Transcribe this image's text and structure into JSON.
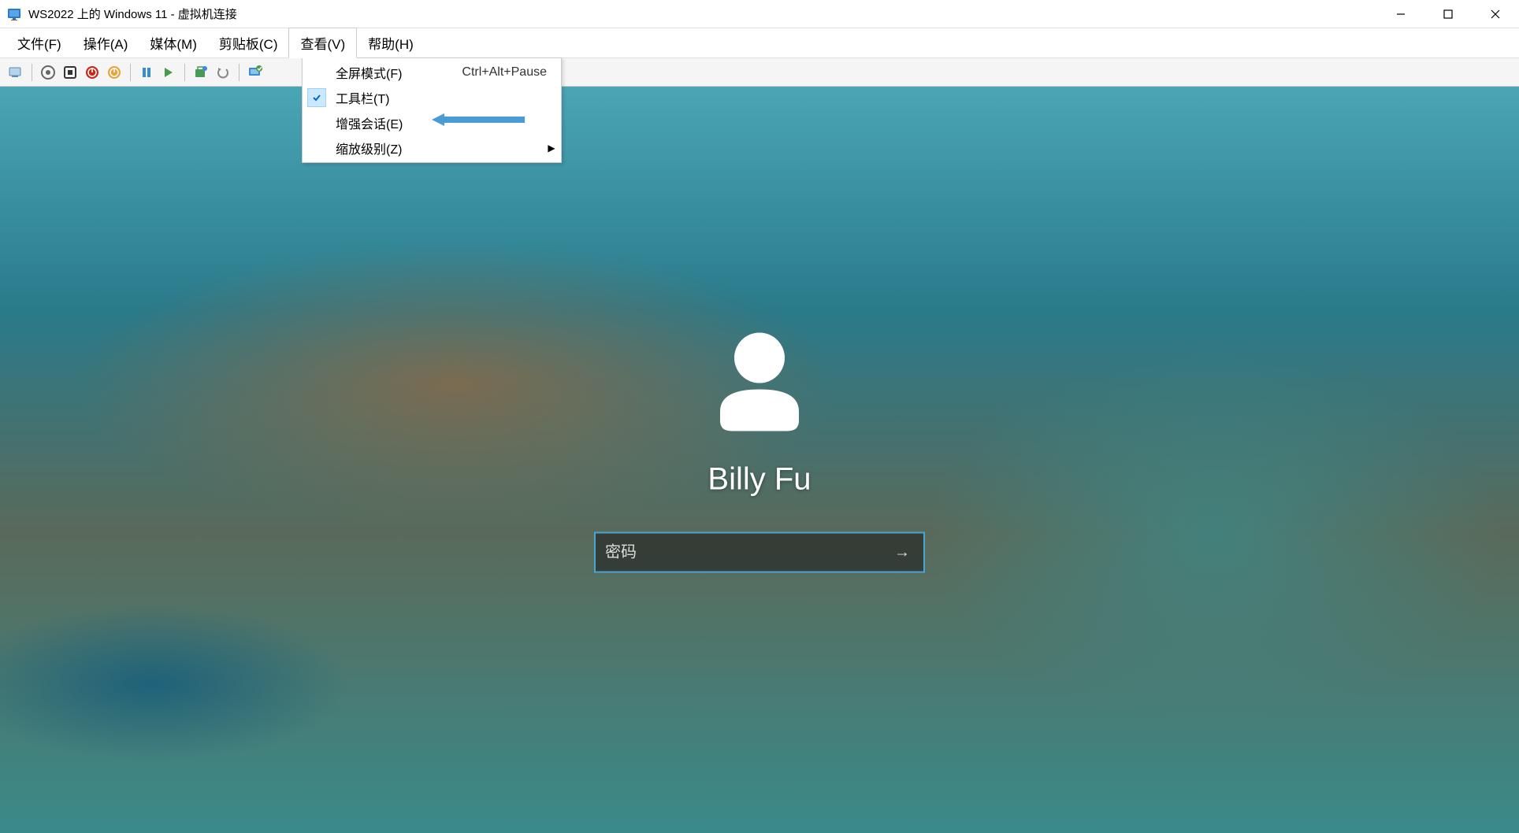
{
  "window": {
    "title": "WS2022 上的 Windows 11 - 虚拟机连接"
  },
  "menubar": {
    "file": "文件(F)",
    "action": "操作(A)",
    "media": "媒体(M)",
    "clipboard": "剪贴板(C)",
    "view": "查看(V)",
    "help": "帮助(H)"
  },
  "view_menu": {
    "fullscreen": {
      "label": "全屏模式(F)",
      "accel": "Ctrl+Alt+Pause"
    },
    "toolbar": {
      "label": "工具栏(T)",
      "checked": true
    },
    "enhanced": {
      "label": "增强会话(E)"
    },
    "zoom": {
      "label": "缩放级别(Z)"
    }
  },
  "lockscreen": {
    "username": "Billy Fu",
    "password_placeholder": "密码"
  }
}
